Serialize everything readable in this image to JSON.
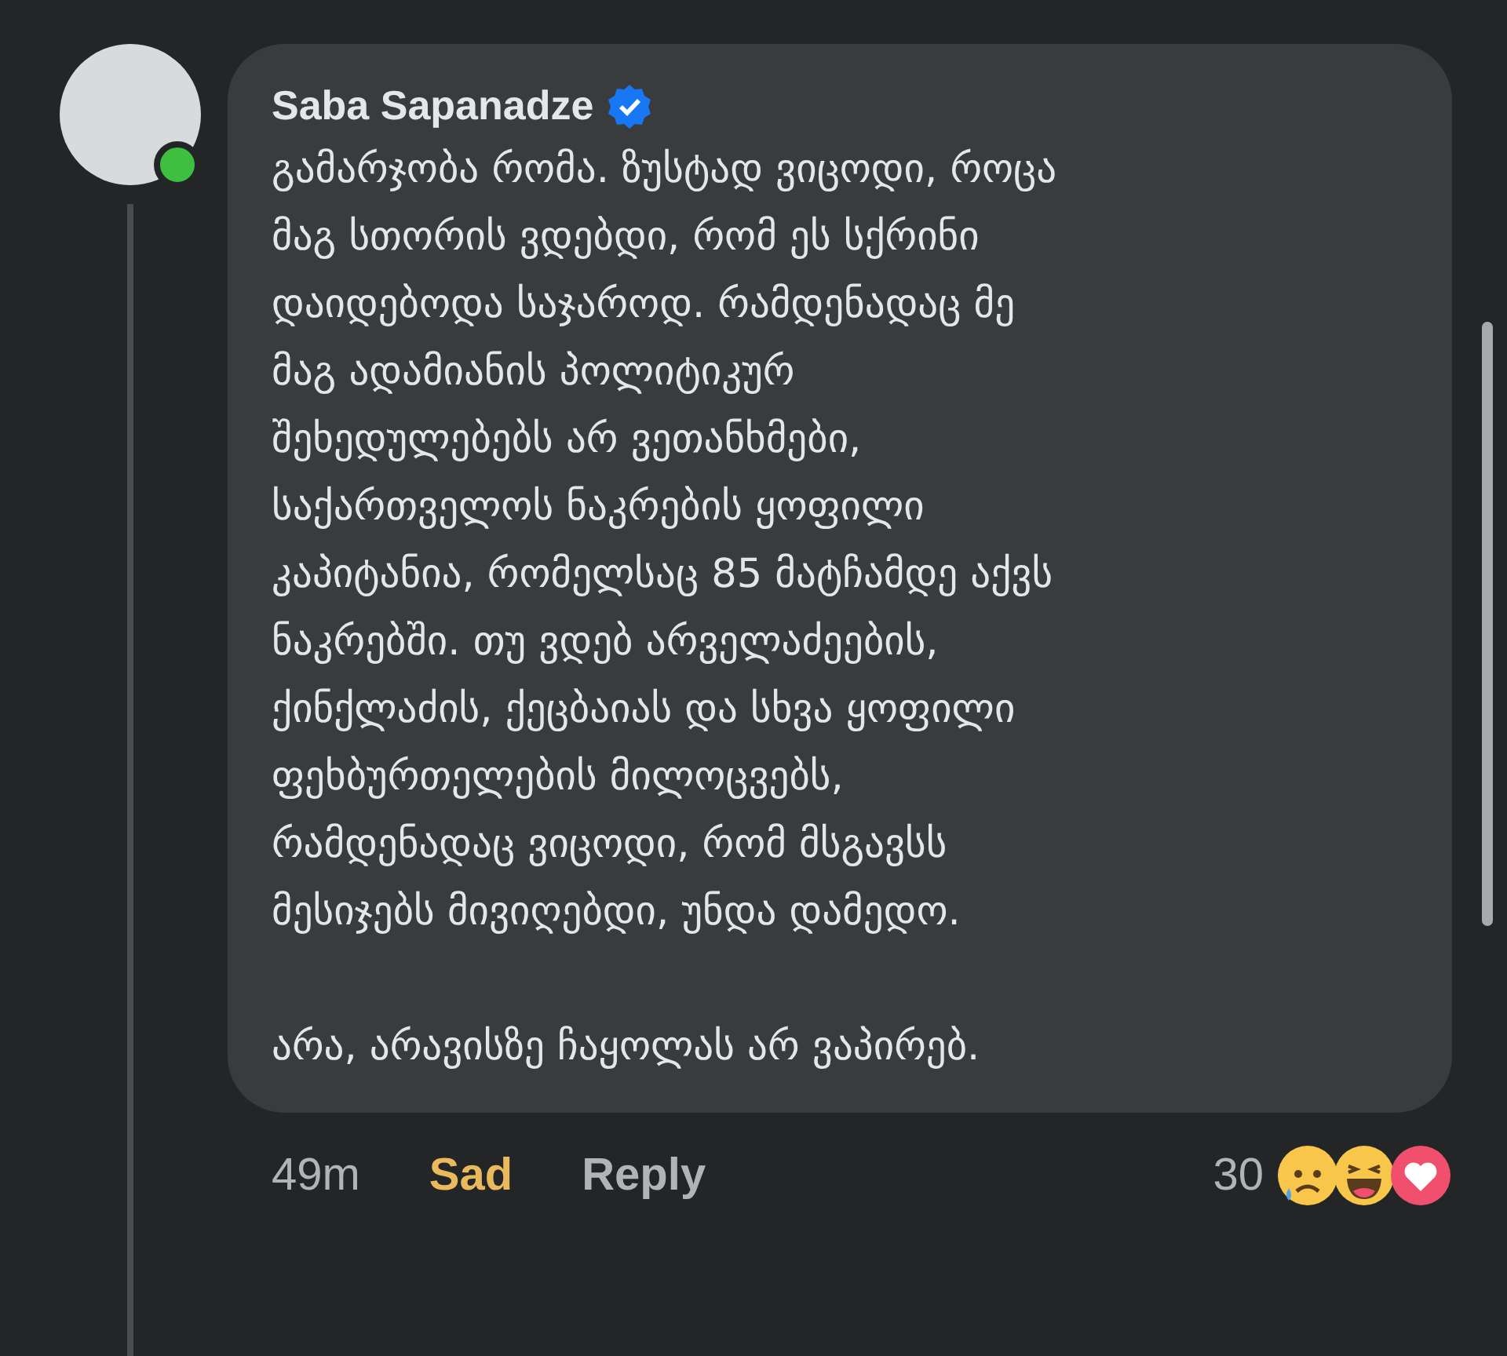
{
  "comment": {
    "author": "Saba Sapanadze",
    "verified": true,
    "online": true,
    "paragraphs": [
      "გამარჯობა რომა. ზუსტად ვიცოდი, როცა\nმაგ სთორის ვდებდი, რომ ეს სქრინი\nდაიდებოდა საჯაროდ. რამდენადაც მე\nმაგ ადამიანის პოლიტიკურ\nშეხედულებებს არ ვეთანხმები,\nსაქართველოს ნაკრების ყოფილი\nკაპიტანია, რომელსაც 85 მატჩამდე აქვს\nნაკრებში. თუ ვდებ არველაძეების,\nქინქლაძის, ქეცბაიას და სხვა ყოფილი\nფეხბურთელების მილოცვებს,\nრამდენადაც ვიცოდი, რომ მსგავსს\nმესიჯებს მივიღებდი, უნდა დამედო.",
      "არა, არავისზე ჩაყოლას არ ვაპირებ."
    ]
  },
  "footer": {
    "time": "49m",
    "my_reaction": {
      "label": "Sad",
      "kind": "sad"
    },
    "reply": "Reply",
    "reaction_count": "30",
    "reactions": [
      {
        "kind": "sad"
      },
      {
        "kind": "haha"
      },
      {
        "kind": "love"
      }
    ]
  }
}
